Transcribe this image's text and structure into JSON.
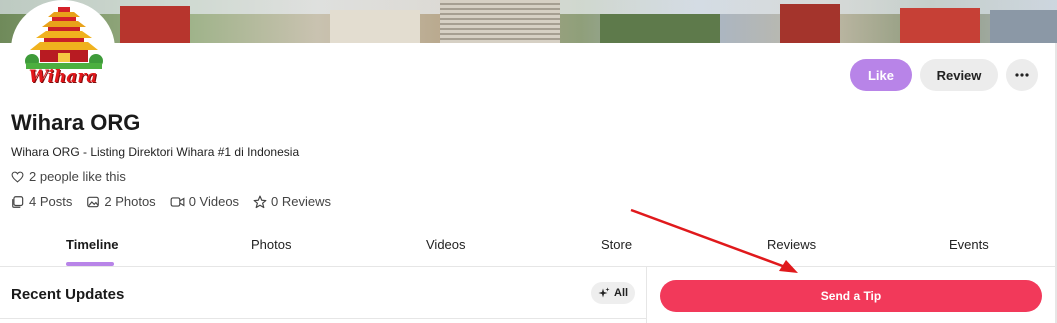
{
  "page": {
    "title": "Wihara ORG",
    "subtitle": "Wihara ORG - Listing Direktori Wihara #1 di Indonesia",
    "logo_text": "Wihara"
  },
  "header_actions": {
    "like_label": "Like",
    "review_label": "Review",
    "more_icon": "ellipsis-icon"
  },
  "likes": {
    "text": "2 people like this",
    "icon": "heart-icon"
  },
  "stats": [
    {
      "label": "4 Posts",
      "icon": "posts-icon"
    },
    {
      "label": "2 Photos",
      "icon": "photos-icon"
    },
    {
      "label": "0 Videos",
      "icon": "video-icon"
    },
    {
      "label": "0 Reviews",
      "icon": "star-icon"
    }
  ],
  "tabs": [
    {
      "label": "Timeline",
      "active": true
    },
    {
      "label": "Photos"
    },
    {
      "label": "Videos"
    },
    {
      "label": "Store"
    },
    {
      "label": "Reviews"
    },
    {
      "label": "Events"
    }
  ],
  "recent": {
    "title": "Recent Updates",
    "filter_label": "All",
    "filter_icon": "sparkle-icon"
  },
  "tip": {
    "label": "Send a Tip"
  },
  "colors": {
    "accent_purple": "#b884e8",
    "tip_red": "#f2395a",
    "annotation_arrow": "#e0191c"
  }
}
